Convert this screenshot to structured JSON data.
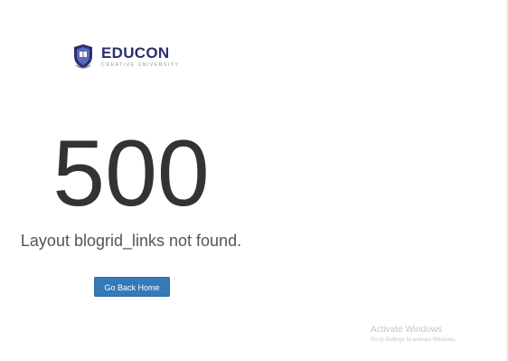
{
  "logo": {
    "name": "EDUCON",
    "tagline": "CREATIVE UNIVERSITY"
  },
  "error": {
    "code": "500",
    "message": "Layout blogrid_links not found."
  },
  "actions": {
    "home_label": "Go Back Home"
  },
  "watermark": {
    "title": "Activate Windows",
    "subtitle": "Go to Settings to activate Windows."
  },
  "colors": {
    "brand": "#2b2f6b",
    "button": "#337ab7",
    "text": "#333333"
  },
  "icons": {
    "crest": "university-crest-icon"
  }
}
